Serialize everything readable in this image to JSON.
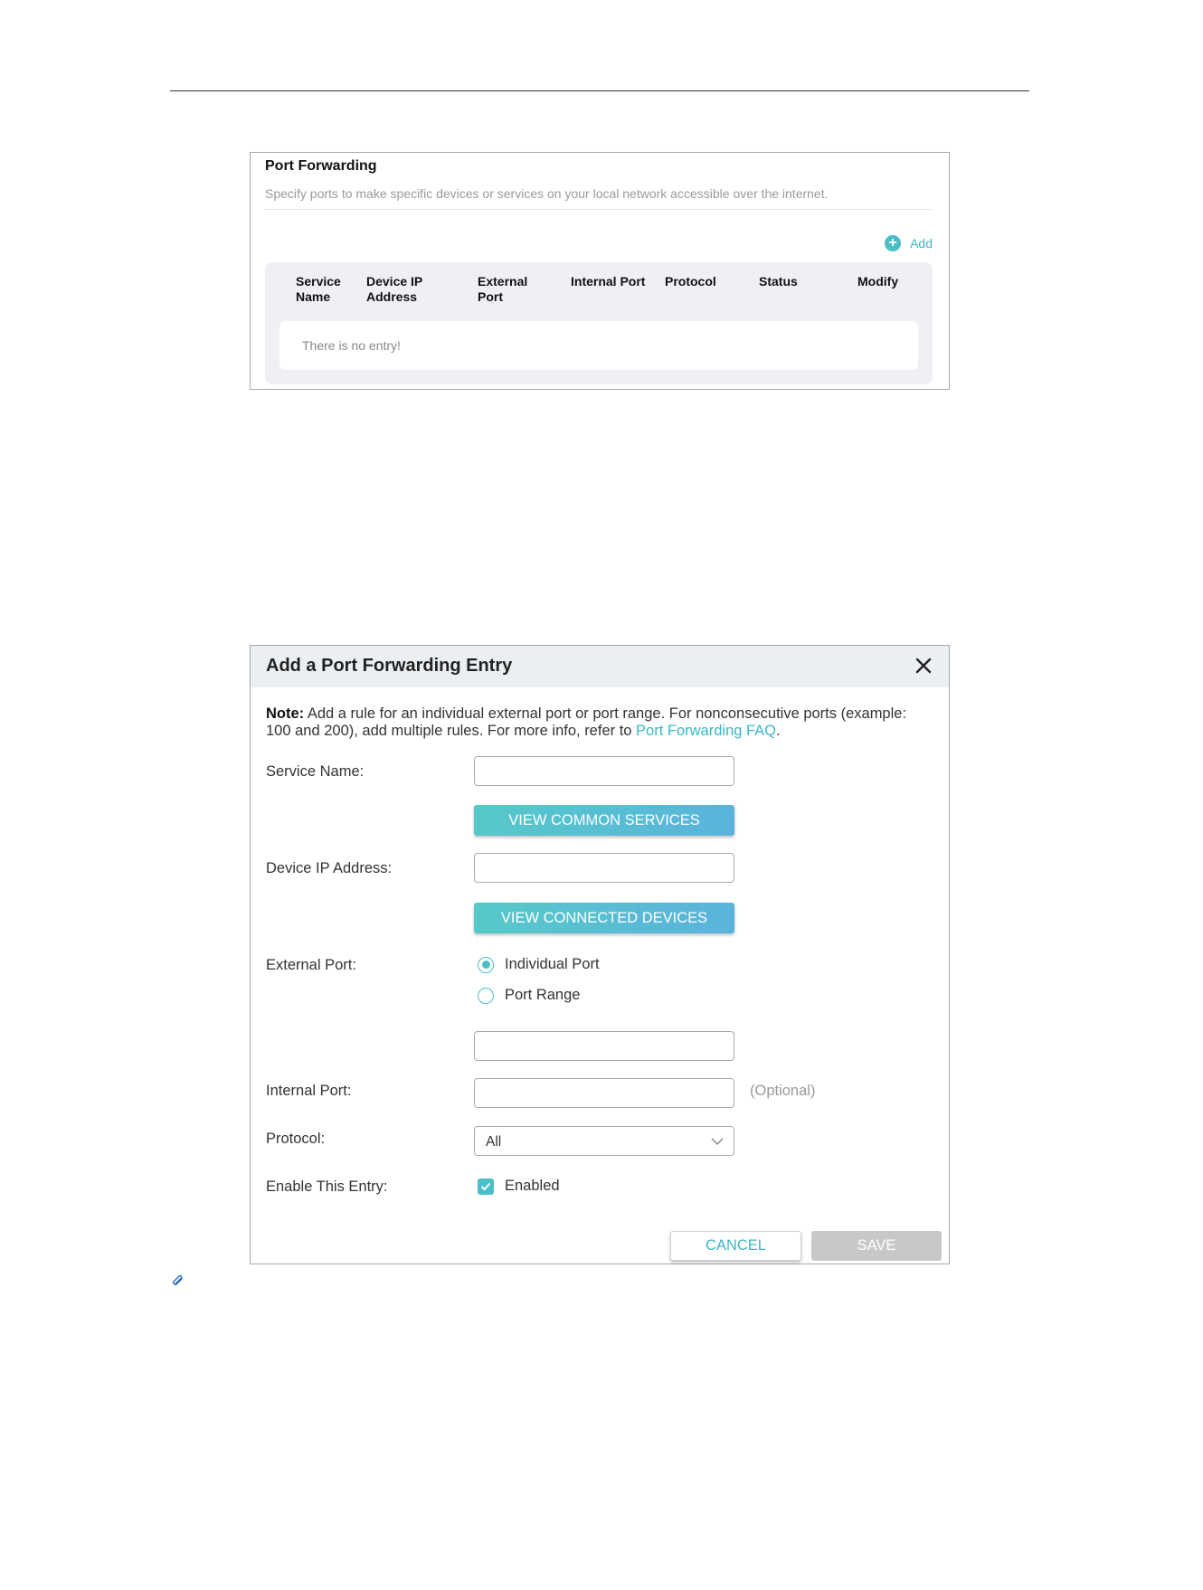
{
  "port_forwarding": {
    "title": "Port Forwarding",
    "description": "Specify ports to make specific devices or services on your local network accessible over the internet.",
    "add_label": "Add",
    "columns": [
      {
        "line1": "Service",
        "line2": "Name"
      },
      {
        "line1": "Device IP",
        "line2": "Address"
      },
      {
        "line1": "External",
        "line2": "Port"
      },
      {
        "line1": "Internal Port",
        "line2": ""
      },
      {
        "line1": "Protocol",
        "line2": ""
      },
      {
        "line1": "Status",
        "line2": ""
      },
      {
        "line1": "Modify",
        "line2": ""
      }
    ],
    "empty_text": "There is no entry!"
  },
  "dialog": {
    "title": "Add a Port Forwarding Entry",
    "note_label": "Note:",
    "note_text": " Add a rule for an individual external port or port range. For nonconsecutive ports (example: 100 and 200), add multiple rules. For more info, refer to ",
    "note_link": "Port Forwarding FAQ",
    "note_end": ".",
    "service_name_label": "Service Name:",
    "service_name_value": "",
    "view_services_label": "VIEW COMMON SERVICES",
    "device_ip_label": "Device IP Address:",
    "device_ip_value": "",
    "view_devices_label": "VIEW CONNECTED DEVICES",
    "external_port_label": "External Port:",
    "radio_individual": "Individual Port",
    "radio_range": "Port Range",
    "external_port_value": "",
    "internal_port_label": "Internal Port:",
    "internal_port_value": "",
    "optional_label": "(Optional)",
    "protocol_label": "Protocol:",
    "protocol_value": "All",
    "enable_label": "Enable This Entry:",
    "enabled_label": "Enabled",
    "cancel_label": "CANCEL",
    "save_label": "SAVE"
  },
  "colors": {
    "accent": "#4bbfc9",
    "button_gradient_start": "#56c9c9",
    "button_gradient_end": "#5ab3dc",
    "disabled": "#c6c8ca"
  }
}
